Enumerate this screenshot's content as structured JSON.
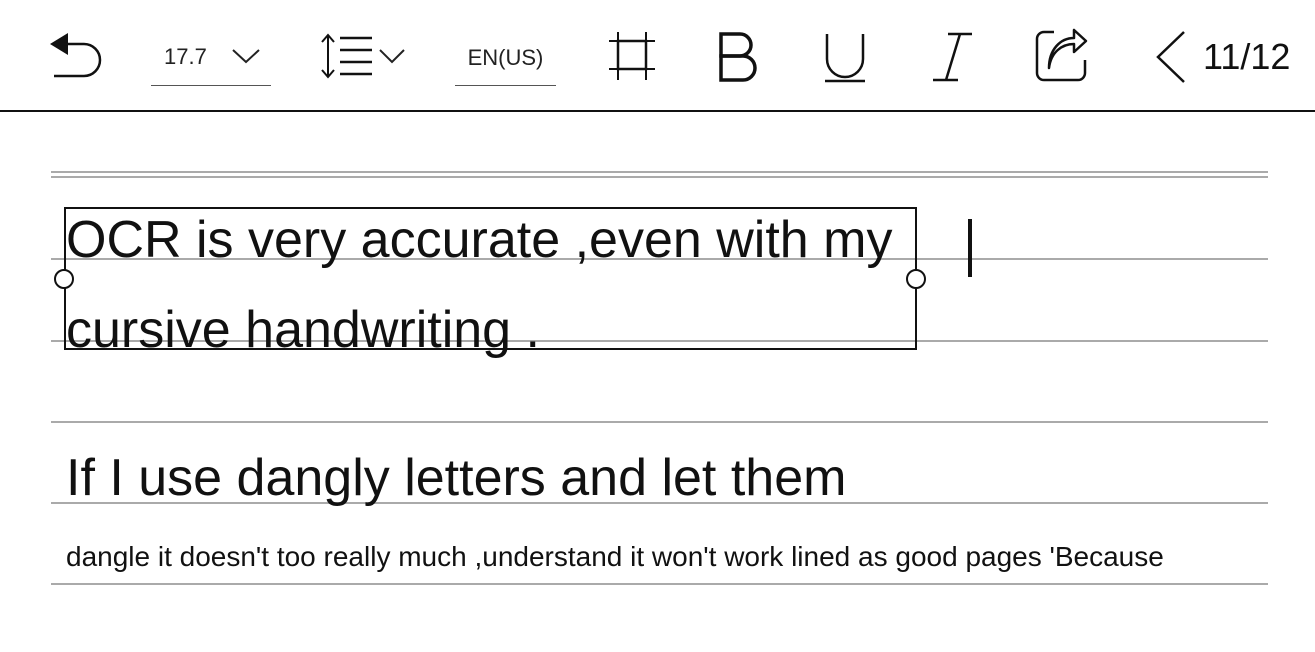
{
  "toolbar": {
    "font_size": "17.7",
    "language": "EN(US)",
    "page_indicator": "11/12",
    "icons": [
      "undo-icon",
      "chevron-down-icon",
      "line-spacing-icon",
      "crop-icon",
      "bold-icon",
      "underline-icon",
      "italic-icon",
      "share-icon",
      "chevron-left-icon"
    ]
  },
  "document": {
    "lines": [
      "OCR is very accurate ,even with my",
      "cursive handwriting .",
      "If I use dangly letters and let them",
      "dangle it doesn't too really much ,understand it won't work lined as good pages 'Because"
    ]
  }
}
